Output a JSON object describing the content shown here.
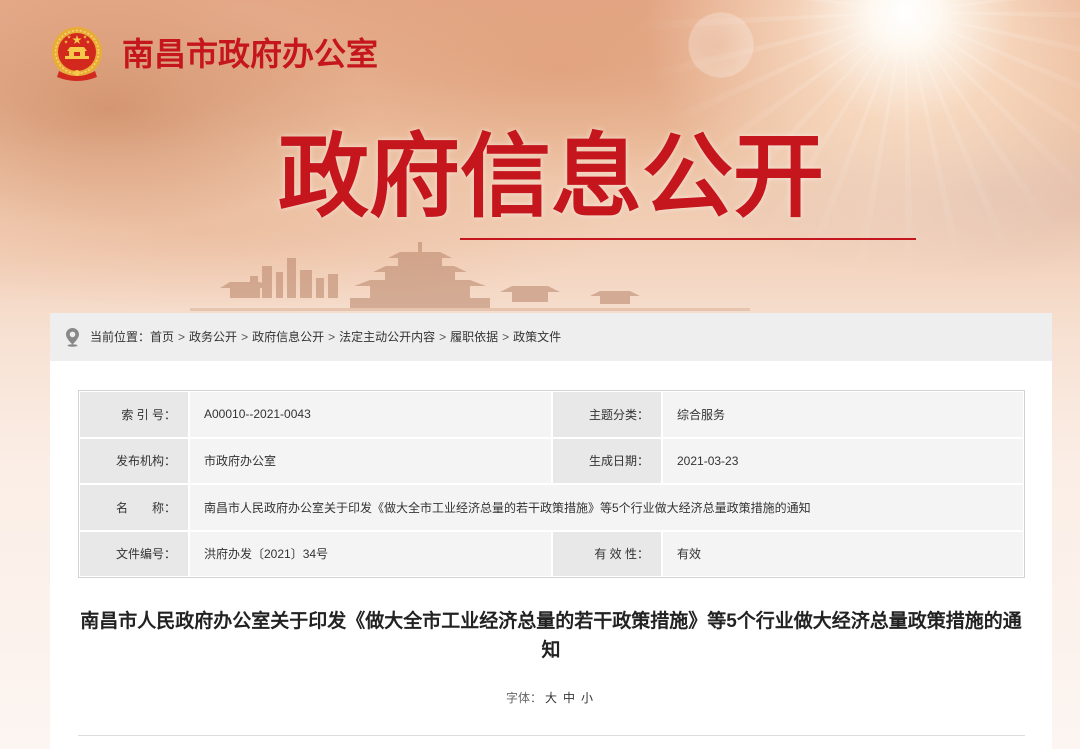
{
  "colors": {
    "brand_red": "#c4161c",
    "breadcrumb_bg": "#eeeeee",
    "meta_label_bg": "#e8e8e8",
    "meta_value_bg": "#f4f4f4",
    "text_dark": "#333333"
  },
  "icons": {
    "emblem": "national-emblem-icon",
    "breadcrumb": "location-pin-icon"
  },
  "header": {
    "org_name": "南昌市政府办公室",
    "banner_title": "政府信息公开"
  },
  "breadcrumb": {
    "prefix": "当前位置：",
    "separator": ">",
    "items": [
      "首页",
      "政务公开",
      "政府信息公开",
      "法定主动公开内容",
      "履职依据",
      "政策文件"
    ]
  },
  "meta": {
    "index": {
      "label": "索 引 号：",
      "value": "A00010--2021-0043"
    },
    "topic": {
      "label": "主题分类：",
      "value": "综合服务"
    },
    "publisher": {
      "label": "发布机构：",
      "value": "市政府办公室"
    },
    "date": {
      "label": "生成日期：",
      "value": "2021-03-23"
    },
    "name": {
      "label": "名　　称：",
      "value": "南昌市人民政府办公室关于印发《做大全市工业经济总量的若干政策措施》等5个行业做大经济总量政策措施的通知"
    },
    "doc_number": {
      "label": "文件编号：",
      "value": "洪府办发〔2021〕34号"
    },
    "validity": {
      "label": "有 效 性：",
      "value": "有效"
    }
  },
  "article": {
    "title": "南昌市人民政府办公室关于印发《做大全市工业经济总量的若干政策措施》等5个行业做大经济总量政策措施的通知",
    "font_size_label": "字体：",
    "font_size_options": [
      "大",
      "中",
      "小"
    ]
  }
}
